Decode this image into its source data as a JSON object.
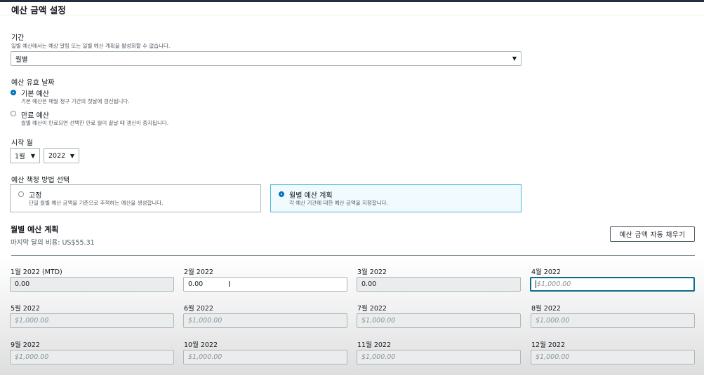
{
  "panel": {
    "title": "예산 금액 설정"
  },
  "period": {
    "label": "기간",
    "description": "일별 예산에서는 예상 알림 또는 일별 예산 계획을 활성화할 수 없습니다.",
    "selected": "월별"
  },
  "renewal": {
    "label": "예산 유효 날짜",
    "options": [
      {
        "label": "기본 예산",
        "description": "기본 예산은 매월 청구 기간의 첫날에 갱신됩니다.",
        "selected": true
      },
      {
        "label": "만료 예산",
        "description": "월별 예산이 만료되면 선택한 만료 월이 끝날 때 갱신이 중지됩니다.",
        "selected": false
      }
    ]
  },
  "start_month": {
    "label": "시작 월",
    "month": "1월",
    "year": "2022"
  },
  "method": {
    "label": "예산 책정 방법 선택",
    "options": [
      {
        "label": "고정",
        "description": "단일 월별 예산 금액을 기준으로 추적하는 예산을 생성합니다.",
        "selected": false
      },
      {
        "label": "월별 예산 계획",
        "description": "각 예산 기간에 대한 예산 금액을 지정합니다.",
        "selected": true
      }
    ]
  },
  "plan": {
    "title": "월별 예산 계획",
    "last_month_cost": "마지막 달의 비용: US$55.31",
    "autofill_button": "예산 금액 자동 채우기"
  },
  "months": [
    {
      "label": "1월 2022 (MTD)",
      "value": "0.00",
      "placeholder": ""
    },
    {
      "label": "2월 2022",
      "value": "0.00",
      "placeholder": ""
    },
    {
      "label": "3월 2022",
      "value": "0.00",
      "placeholder": ""
    },
    {
      "label": "4월 2022",
      "value": "",
      "placeholder": "$1,000.00"
    },
    {
      "label": "5월 2022",
      "value": "",
      "placeholder": "$1,000.00"
    },
    {
      "label": "6월 2022",
      "value": "",
      "placeholder": "$1,000.00"
    },
    {
      "label": "7월 2022",
      "value": "",
      "placeholder": "$1,000.00"
    },
    {
      "label": "8월 2022",
      "value": "",
      "placeholder": "$1,000.00"
    },
    {
      "label": "9월 2022",
      "value": "",
      "placeholder": "$1,000.00"
    },
    {
      "label": "10월 2022",
      "value": "",
      "placeholder": "$1,000.00"
    },
    {
      "label": "11월 2022",
      "value": "",
      "placeholder": "$1,000.00"
    },
    {
      "label": "12월 2022",
      "value": "",
      "placeholder": "$1,000.00"
    }
  ],
  "colors": {
    "accent": "#0073bb",
    "focus_border": "#0b6f87",
    "selected_card_border": "#44b9d6",
    "header_bar": "#232f3e"
  }
}
